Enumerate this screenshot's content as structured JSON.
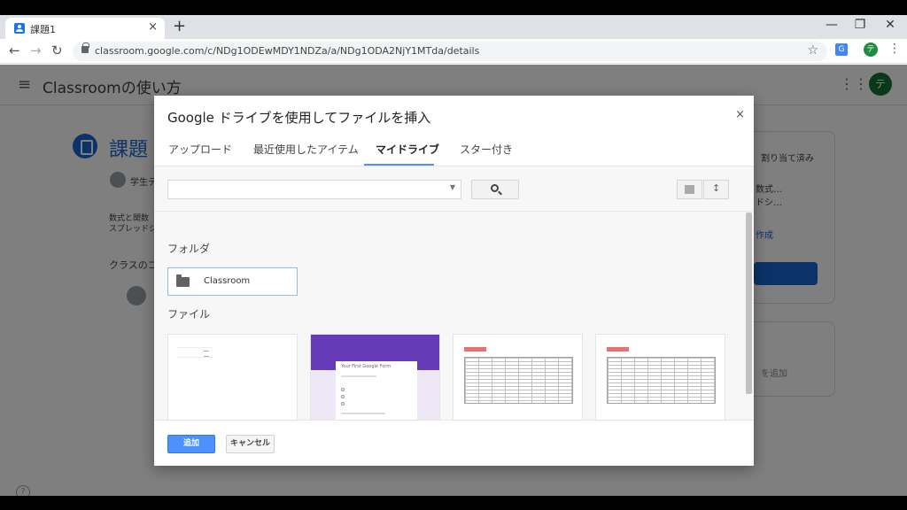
{
  "browser": {
    "tab_title": "課題1",
    "tab_close": "×",
    "new_tab": "+",
    "minimize": "—",
    "restore": "❐",
    "close": "✕",
    "back": "←",
    "forward": "→",
    "reload": "↻",
    "url": "classroom.google.com/c/NDg1ODEwMDY1NDZa/a/NDg1ODA2NjY1MTda/details",
    "star": "☆",
    "profile_initial": "テ",
    "menu": "⋮"
  },
  "app": {
    "hamburger": "≡",
    "title": "Classroomの使い方",
    "apps": "⋮⋮⋮",
    "avatar_initial": "テ"
  },
  "page": {
    "heading": "課題",
    "student_label": "学生テ",
    "desc_line1": "数式と関数",
    "desc_line2": "スプレッドシ",
    "class_comment": "クラスのコ",
    "assigned": "割り当て済み",
    "attach_name": "数式…",
    "attach_type": "ドシ…",
    "create": "作成",
    "private_comment": "を追加",
    "help": "?"
  },
  "dialog": {
    "title": "Google ドライブを使用してファイルを挿入",
    "close": "×",
    "tabs": [
      {
        "label": "アップロード"
      },
      {
        "label": "最近使用したアイテム"
      },
      {
        "label": "マイドライブ"
      },
      {
        "label": "スター付き"
      }
    ],
    "search_placeholder": "",
    "folders_label": "フォルダ",
    "folders": [
      {
        "name": "Classroom"
      }
    ],
    "files_label": "ファイル",
    "form_title": "Your First Google Form",
    "add_button": "追加",
    "cancel_button": "キャンセル"
  },
  "colors": {
    "accent": "#4d90fe",
    "classroom_blue": "#1967d2",
    "form_purple": "#673ab7"
  }
}
